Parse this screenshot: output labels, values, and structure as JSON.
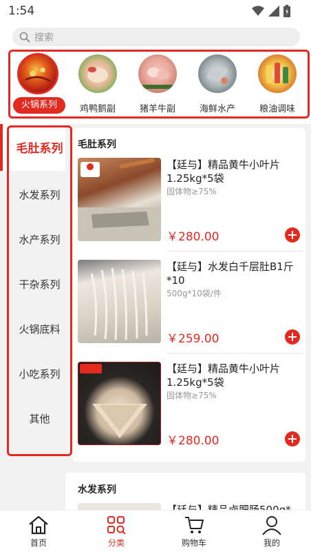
{
  "status": {
    "time": "1:54"
  },
  "search": {
    "placeholder": "搜索"
  },
  "categories": [
    {
      "label": "火锅系列",
      "active": true
    },
    {
      "label": "鸡鸭鹅副",
      "active": false
    },
    {
      "label": "猪羊牛副",
      "active": false
    },
    {
      "label": "海鲜水产",
      "active": false
    },
    {
      "label": "粮油调味",
      "active": false
    }
  ],
  "sidebar": {
    "items": [
      {
        "label": "毛肚系列",
        "active": true
      },
      {
        "label": "水发系列"
      },
      {
        "label": "水产系列"
      },
      {
        "label": "干杂系列"
      },
      {
        "label": "火锅底料"
      },
      {
        "label": "小吃系列"
      },
      {
        "label": "其他"
      }
    ]
  },
  "sections": [
    {
      "title": "毛肚系列",
      "products": [
        {
          "name": "【廷与】精品黄牛小叶片1.25kg*5袋",
          "spec": "固体物≥75%",
          "price": "￥280.00",
          "badge": "福香有料"
        },
        {
          "name": "【廷与】水发白千层肚B1斤*10",
          "spec": "500g*10袋/件",
          "price": "￥259.00"
        },
        {
          "name": "【廷与】精品黄牛小叶片1.25kg*5袋",
          "spec": "固体物≥75%",
          "price": "￥280.00",
          "badge": "福香有料"
        }
      ]
    },
    {
      "title": "水发系列",
      "products": [
        {
          "name": "【廷与】精品卤肥肠500g*"
        }
      ]
    }
  ],
  "bottom_nav": [
    {
      "label": "首页",
      "icon": "home-icon"
    },
    {
      "label": "分类",
      "icon": "category-icon",
      "active": true
    },
    {
      "label": "购物车",
      "icon": "cart-icon"
    },
    {
      "label": "我的",
      "icon": "user-icon"
    }
  ],
  "colors": {
    "accent": "#e32a20",
    "background": "#f2f2f2"
  }
}
